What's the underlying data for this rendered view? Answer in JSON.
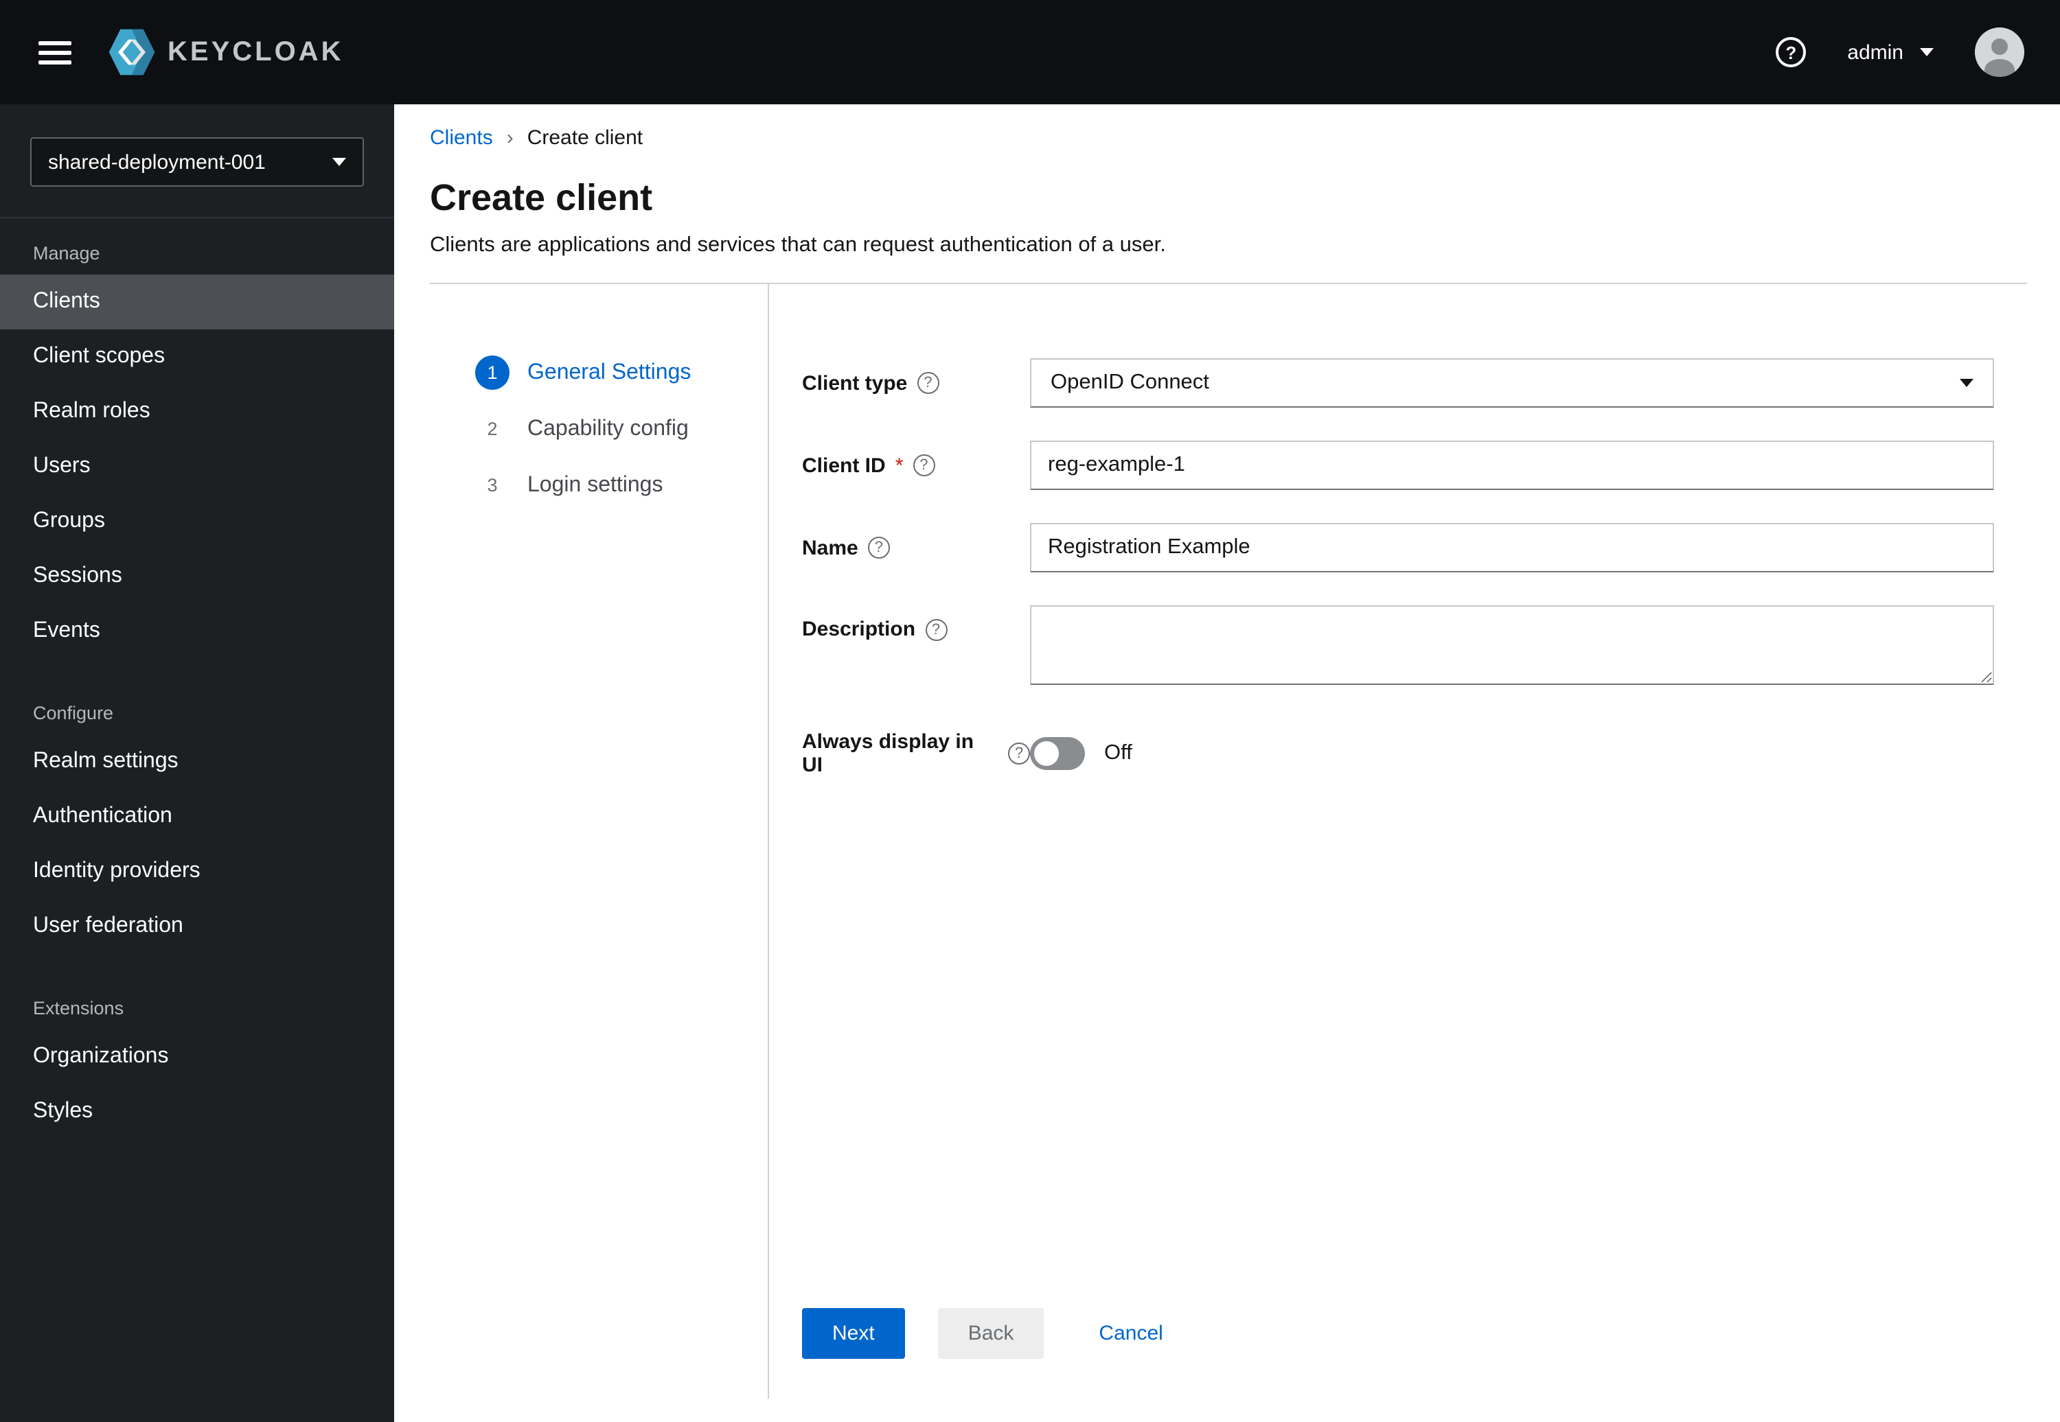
{
  "topbar": {
    "brand": "KEYCLOAK",
    "user": "admin"
  },
  "sidebar": {
    "realm": "shared-deployment-001",
    "sections": [
      {
        "label": "Manage",
        "items": [
          "Clients",
          "Client scopes",
          "Realm roles",
          "Users",
          "Groups",
          "Sessions",
          "Events"
        ]
      },
      {
        "label": "Configure",
        "items": [
          "Realm settings",
          "Authentication",
          "Identity providers",
          "User federation"
        ]
      },
      {
        "label": "Extensions",
        "items": [
          "Organizations",
          "Styles"
        ]
      }
    ],
    "selected_item": "Clients"
  },
  "breadcrumb": {
    "items": [
      "Clients",
      "Create client"
    ]
  },
  "page": {
    "title": "Create client",
    "subtitle": "Clients are applications and services that can request authentication of a user."
  },
  "wizard": {
    "steps": [
      {
        "number": "1",
        "label": "General Settings",
        "active": true
      },
      {
        "number": "2",
        "label": "Capability config",
        "active": false
      },
      {
        "number": "3",
        "label": "Login settings",
        "active": false
      }
    ]
  },
  "form": {
    "client_type": {
      "label": "Client type",
      "value": "OpenID Connect"
    },
    "client_id": {
      "label": "Client ID",
      "required_marker": "*",
      "value": "reg-example-1"
    },
    "name": {
      "label": "Name",
      "value": "Registration Example"
    },
    "description": {
      "label": "Description",
      "value": ""
    },
    "always_display": {
      "label": "Always display in UI",
      "state_label": "Off"
    }
  },
  "actions": {
    "next": "Next",
    "back": "Back",
    "cancel": "Cancel"
  },
  "colors": {
    "accent": "#0066cc",
    "danger": "#c9190b",
    "masthead": "#0d0f12",
    "sidebar": "#1d2023"
  }
}
